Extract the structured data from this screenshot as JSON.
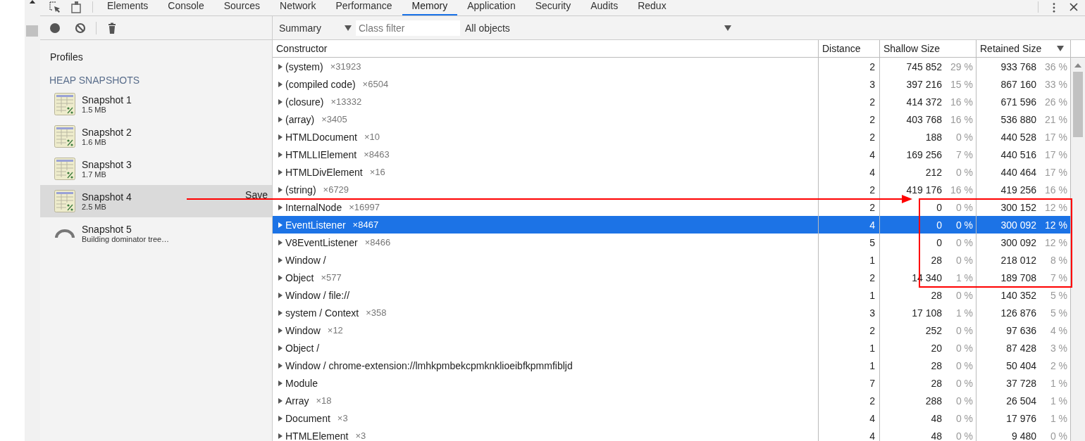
{
  "tabs": [
    {
      "label": "Elements",
      "selected": false
    },
    {
      "label": "Console",
      "selected": false
    },
    {
      "label": "Sources",
      "selected": false
    },
    {
      "label": "Network",
      "selected": false
    },
    {
      "label": "Performance",
      "selected": false
    },
    {
      "label": "Memory",
      "selected": true
    },
    {
      "label": "Application",
      "selected": false
    },
    {
      "label": "Security",
      "selected": false
    },
    {
      "label": "Audits",
      "selected": false
    },
    {
      "label": "Redux",
      "selected": false
    }
  ],
  "filter_bar": {
    "view": "Summary",
    "class_filter": {
      "placeholder": "Class filter"
    },
    "objects": "All objects"
  },
  "sidebar": {
    "heading": "Profiles",
    "section": "HEAP SNAPSHOTS",
    "items": [
      {
        "kind": "snapshot",
        "title": "Snapshot 1",
        "detail": "1.5 MB",
        "selected": false
      },
      {
        "kind": "snapshot",
        "title": "Snapshot 2",
        "detail": "1.6 MB",
        "selected": false
      },
      {
        "kind": "snapshot",
        "title": "Snapshot 3",
        "detail": "1.7 MB",
        "selected": false
      },
      {
        "kind": "snapshot",
        "title": "Snapshot 4",
        "detail": "2.5 MB",
        "selected": true,
        "action": "Save"
      },
      {
        "kind": "building",
        "title": "Snapshot 5",
        "detail": "Building dominator tree…",
        "selected": false
      }
    ]
  },
  "table": {
    "columns": [
      {
        "label": "Constructor",
        "sorted": false
      },
      {
        "label": "Distance",
        "sorted": false
      },
      {
        "label": "Shallow Size",
        "sorted": false
      },
      {
        "label": "Retained Size",
        "sorted": true
      }
    ],
    "rows": [
      {
        "name": "(system)",
        "count": "×31923",
        "distance": "2",
        "shallow": "745 852",
        "shallow_pct": "29 %",
        "retained": "933 768",
        "retained_pct": "36 %",
        "selected": false
      },
      {
        "name": "(compiled code)",
        "count": "×6504",
        "distance": "3",
        "shallow": "397 216",
        "shallow_pct": "15 %",
        "retained": "867 160",
        "retained_pct": "33 %",
        "selected": false
      },
      {
        "name": "(closure)",
        "count": "×13332",
        "distance": "2",
        "shallow": "414 372",
        "shallow_pct": "16 %",
        "retained": "671 596",
        "retained_pct": "26 %",
        "selected": false
      },
      {
        "name": "(array)",
        "count": "×3405",
        "distance": "2",
        "shallow": "403 768",
        "shallow_pct": "16 %",
        "retained": "536 880",
        "retained_pct": "21 %",
        "selected": false
      },
      {
        "name": "HTMLDocument",
        "count": "×10",
        "distance": "2",
        "shallow": "188",
        "shallow_pct": "0 %",
        "retained": "440 528",
        "retained_pct": "17 %",
        "selected": false
      },
      {
        "name": "HTMLLIElement",
        "count": "×8463",
        "distance": "4",
        "shallow": "169 256",
        "shallow_pct": "7 %",
        "retained": "440 516",
        "retained_pct": "17 %",
        "selected": false
      },
      {
        "name": "HTMLDivElement",
        "count": "×16",
        "distance": "4",
        "shallow": "212",
        "shallow_pct": "0 %",
        "retained": "440 464",
        "retained_pct": "17 %",
        "selected": false
      },
      {
        "name": "(string)",
        "count": "×6729",
        "distance": "2",
        "shallow": "419 176",
        "shallow_pct": "16 %",
        "retained": "419 256",
        "retained_pct": "16 %",
        "selected": false
      },
      {
        "name": "InternalNode",
        "count": "×16997",
        "distance": "2",
        "shallow": "0",
        "shallow_pct": "0 %",
        "retained": "300 152",
        "retained_pct": "12 %",
        "selected": false
      },
      {
        "name": "EventListener",
        "count": "×8467",
        "distance": "4",
        "shallow": "0",
        "shallow_pct": "0 %",
        "retained": "300 092",
        "retained_pct": "12 %",
        "selected": true
      },
      {
        "name": "V8EventListener",
        "count": "×8466",
        "distance": "5",
        "shallow": "0",
        "shallow_pct": "0 %",
        "retained": "300 092",
        "retained_pct": "12 %",
        "selected": false
      },
      {
        "name": "Window /",
        "distance": "1",
        "shallow": "28",
        "shallow_pct": "0 %",
        "retained": "218 012",
        "retained_pct": "8 %",
        "selected": false
      },
      {
        "name": "Object",
        "count": "×577",
        "distance": "2",
        "shallow": "14 340",
        "shallow_pct": "1 %",
        "retained": "189 708",
        "retained_pct": "7 %",
        "selected": false
      },
      {
        "name": "Window / file://",
        "distance": "1",
        "shallow": "28",
        "shallow_pct": "0 %",
        "retained": "140 352",
        "retained_pct": "5 %",
        "selected": false
      },
      {
        "name": "system / Context",
        "count": "×358",
        "distance": "3",
        "shallow": "17 108",
        "shallow_pct": "1 %",
        "retained": "126 876",
        "retained_pct": "5 %",
        "selected": false
      },
      {
        "name": "Window",
        "count": "×12",
        "distance": "2",
        "shallow": "252",
        "shallow_pct": "0 %",
        "retained": "97 636",
        "retained_pct": "4 %",
        "selected": false
      },
      {
        "name": "Object /",
        "distance": "1",
        "shallow": "20",
        "shallow_pct": "0 %",
        "retained": "87 428",
        "retained_pct": "3 %",
        "selected": false
      },
      {
        "name": "Window / chrome-extension://lmhkpmbekcpmknklioeibfkpmmfibljd",
        "distance": "1",
        "shallow": "28",
        "shallow_pct": "0 %",
        "retained": "50 404",
        "retained_pct": "2 %",
        "selected": false
      },
      {
        "name": "Module",
        "distance": "7",
        "shallow": "28",
        "shallow_pct": "0 %",
        "retained": "37 728",
        "retained_pct": "1 %",
        "selected": false
      },
      {
        "name": "Array",
        "count": "×18",
        "distance": "2",
        "shallow": "288",
        "shallow_pct": "0 %",
        "retained": "26 504",
        "retained_pct": "1 %",
        "selected": false
      },
      {
        "name": "Document",
        "count": "×3",
        "distance": "4",
        "shallow": "48",
        "shallow_pct": "0 %",
        "retained": "17 976",
        "retained_pct": "1 %",
        "selected": false
      },
      {
        "name": "HTMLElement",
        "count": "×3",
        "distance": "4",
        "shallow": "48",
        "shallow_pct": "0 %",
        "retained": "9 480",
        "retained_pct": "0 %",
        "selected": false
      }
    ]
  }
}
